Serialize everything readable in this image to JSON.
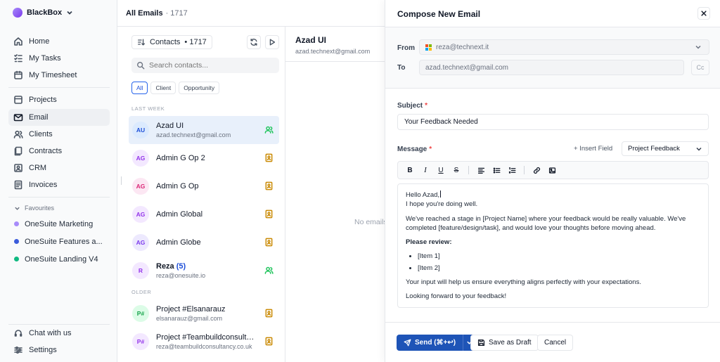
{
  "sidebar": {
    "brand": "BlackBox",
    "nav_primary": [
      {
        "label": "Home",
        "icon": "home-icon"
      },
      {
        "label": "My Tasks",
        "icon": "tasks-icon"
      },
      {
        "label": "My Timesheet",
        "icon": "timesheet-icon"
      }
    ],
    "nav_secondary": [
      {
        "label": "Projects",
        "icon": "projects-icon"
      },
      {
        "label": "Email",
        "icon": "mail-icon",
        "active": true
      },
      {
        "label": "Clients",
        "icon": "clients-icon"
      },
      {
        "label": "Contracts",
        "icon": "contracts-icon"
      },
      {
        "label": "CRM",
        "icon": "crm-icon"
      },
      {
        "label": "Invoices",
        "icon": "invoices-icon"
      }
    ],
    "favourites_label": "Favourites",
    "favourites": [
      {
        "label": "OneSuite Marketing",
        "color": "#a78bfa"
      },
      {
        "label": "OneSuite Features a...",
        "color": "#3b5bdb"
      },
      {
        "label": "OneSuite Landing V4",
        "color": "#10b981"
      }
    ],
    "bottom": [
      {
        "label": "Chat with us",
        "icon": "chat-icon"
      },
      {
        "label": "Settings",
        "icon": "settings-icon"
      }
    ]
  },
  "header": {
    "title": "All Emails",
    "count": "· 1717"
  },
  "contacts": {
    "filter_label": "Contacts",
    "filter_count": "• 1717",
    "search_placeholder": "Search contacts...",
    "chips": [
      "All",
      "Client",
      "Opportunity"
    ],
    "section_last_week": "LAST WEEK",
    "section_older": "OLDER",
    "last_week": [
      {
        "initials": "AU",
        "name": "Azad UI",
        "email": "azad.technext@gmail.com",
        "type": "client",
        "active": true
      },
      {
        "initials": "AG",
        "name": "Admin G Op 2",
        "email": "",
        "type": "opportunity"
      },
      {
        "initials": "AG",
        "name": "Admin G Op",
        "email": "",
        "type": "opportunity"
      },
      {
        "initials": "AG",
        "name": "Admin Global",
        "email": "",
        "type": "opportunity"
      },
      {
        "initials": "AG",
        "name": "Admin Globe",
        "email": "",
        "type": "opportunity"
      },
      {
        "initials": "R",
        "name": "Reza",
        "badge": "(5)",
        "email": "reza@onesuite.io",
        "type": "client"
      }
    ],
    "older": [
      {
        "initials": "P#",
        "name": "Project #Elsanarauz",
        "email": "elsanarauz@gmail.com",
        "type": "opportunity"
      },
      {
        "initials": "P#",
        "name": "Project #Teambuildconsultan...",
        "email": "reza@teambuildconsultancy.co.uk",
        "type": "opportunity"
      }
    ]
  },
  "detail": {
    "name": "Azad UI",
    "email": "azad.technext@gmail.com",
    "empty": "No emails"
  },
  "compose": {
    "title": "Compose New Email",
    "from_label": "From",
    "from_value": "reza@technext.it",
    "to_label": "To",
    "to_value": "azad.technext@gmail.com",
    "cc_label": "Cc",
    "subject_label": "Subject",
    "subject_value": "Your Feedback Needed",
    "message_label": "Message",
    "insert_field": "+ Insert Field",
    "template": "Project Feedback",
    "body": {
      "greeting": "Hello Azad,",
      "line1": "I hope you're doing well.",
      "para1": "We've reached a stage in [Project Name] where your feedback would be really valuable. We've completed [feature/design/task], and would love your thoughts before moving ahead.",
      "review_heading": "Please review:",
      "items": [
        "[Item 1]",
        "[Item 2]"
      ],
      "para2": "Your input will help us ensure everything aligns perfectly with your expectations.",
      "closing": "Looking forward to your feedback!"
    },
    "send_label": "Send (⌘+↩)",
    "draft_label": "Save as Draft",
    "cancel_label": "Cancel"
  },
  "colors": {
    "accent": "#1e54b7",
    "active_row": "#e8f0fb",
    "client_icon": "#22c55e",
    "opportunity_icon": "#ca8a04"
  }
}
